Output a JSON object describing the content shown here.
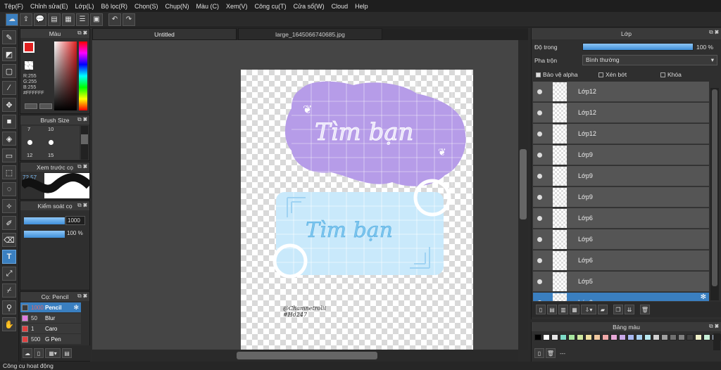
{
  "menu": [
    "Tệp(F)",
    "Chỉnh sửa(E)",
    "Lớp(L)",
    "Bộ lọc(R)",
    "Chọn(S)",
    "Chụp(N)",
    "Màu (C)",
    "Xem(V)",
    "Công cụ(T)",
    "Cửa sổ(W)",
    "Cloud",
    "Help"
  ],
  "tabs": [
    "Untitled",
    "large_1645066740685.jpg"
  ],
  "color_panel": {
    "title": "Màu",
    "r": "R:255",
    "g": "G:255",
    "b": "B:255",
    "hex": "#FFFFFF"
  },
  "brush_size_panel": {
    "title": "Brush Size",
    "sizes": [
      "7",
      "10",
      "12",
      "15"
    ]
  },
  "preview_panel": {
    "title": "Xem trước cọ",
    "value": "72.57"
  },
  "control_panel": {
    "title": "Kiểm soát cọ",
    "size": "1000",
    "opacity": "100 %"
  },
  "brush_list": {
    "title": "Cọ: Pencil",
    "items": [
      {
        "size": "1000",
        "name": "Pencil",
        "color": "#3b3b3b"
      },
      {
        "size": "50",
        "name": "Blur",
        "color": "#e07be0"
      },
      {
        "size": "1",
        "name": "Caro",
        "color": "#e04040"
      },
      {
        "size": "500",
        "name": "G Pen",
        "color": "#e04040"
      }
    ]
  },
  "artwork": {
    "top_text": "Tìm bạn",
    "bottom_text": "Tìm bạn",
    "credit_1": "@Chamnetrolii",
    "credit_2": "#Hd247"
  },
  "layers_panel": {
    "title": "Lớp",
    "opacity_label": "Độ trong",
    "opacity_value": "100 %",
    "blend_label": "Pha trộn",
    "blend_value": "Bình thường",
    "protect_alpha": "Bảo vệ alpha",
    "clipping": "Xén bớt",
    "lock": "Khóa",
    "layers": [
      "Lớp12",
      "Lớp12",
      "Lớp12",
      "Lớp9",
      "Lớp9",
      "Lớp9",
      "Lớp6",
      "Lớp6",
      "Lớp6",
      "Lớp5",
      "Lớp3"
    ]
  },
  "palette_panel": {
    "title": "Bảng màu",
    "footer": "---"
  },
  "status": "Công cụ hoạt động",
  "colors": {
    "accent": "#3a7fc0",
    "purple_blob": "#b69ce8",
    "blue_card": "#c9e9fb"
  }
}
